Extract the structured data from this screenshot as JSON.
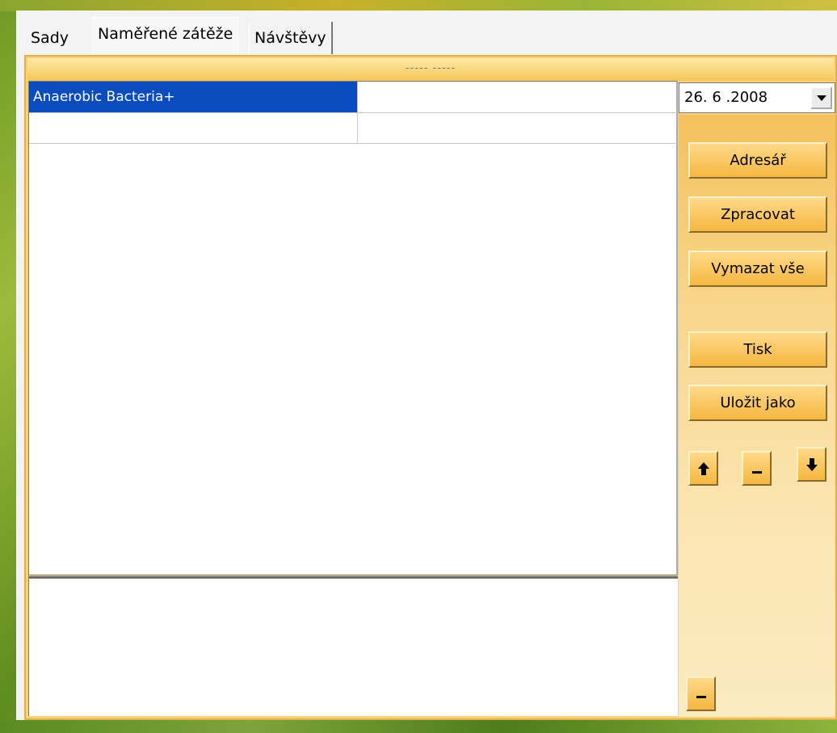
{
  "tabs": [
    {
      "label": "Sady"
    },
    {
      "label": "Naměřené zátěže"
    },
    {
      "label": "Návštěvy"
    }
  ],
  "header_strip": "----- -----",
  "grid": {
    "rows": [
      {
        "name": "Anaerobic Bacteria+",
        "value": ""
      },
      {
        "name": "",
        "value": ""
      }
    ]
  },
  "date_picker": {
    "value": "26. 6 .2008"
  },
  "buttons": {
    "adresar": "Adresář",
    "zpracovat": "Zpracovat",
    "vymazat_vse": "Vymazat vše",
    "tisk": "Tisk",
    "ulozit_jako": "Uložit jako"
  },
  "icons": [
    "arrow-up-icon",
    "minus-icon",
    "arrow-down-icon",
    "chevron-down-icon"
  ],
  "colors": {
    "selection": "#0a4cbf",
    "button": "#f5b740",
    "panel": "#f6d27a"
  }
}
